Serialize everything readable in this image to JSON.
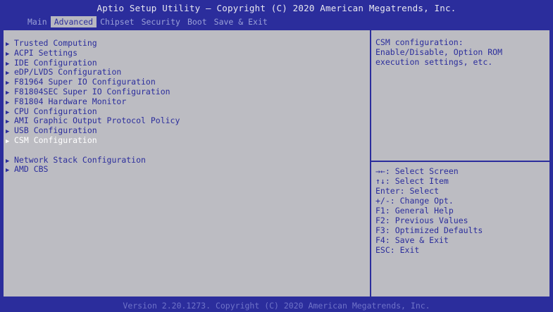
{
  "title": "Aptio Setup Utility – Copyright (C) 2020 American Megatrends, Inc.",
  "tabs": [
    "Main",
    "Advanced",
    "Chipset",
    "Security",
    "Boot",
    "Save & Exit"
  ],
  "active_tab": "Advanced",
  "menu": [
    "Trusted Computing",
    "ACPI Settings",
    "IDE Configuration",
    "eDP/LVDS Configuration",
    "F81964 Super IO Configuration",
    "F81804SEC Super IO Configuration",
    "F81804 Hardware Monitor",
    "CPU Configuration",
    "AMI Graphic Output Protocol Policy",
    "USB Configuration",
    "CSM Configuration",
    "Network Stack Configuration",
    "AMD CBS"
  ],
  "selected_item": "CSM Configuration",
  "help": [
    "CSM configuration:",
    "Enable/Disable, Option ROM",
    "execution settings, etc."
  ],
  "keys": [
    "→←: Select Screen",
    "↑↓: Select Item",
    "Enter: Select",
    "+/-: Change Opt.",
    "F1: General Help",
    "F2: Previous Values",
    "F3: Optimized Defaults",
    "F4: Save & Exit",
    "ESC: Exit"
  ],
  "footer": "Version 2.20.1273. Copyright (C) 2020 American Megatrends, Inc.",
  "colors": {
    "background": "#2b2d9c",
    "panel": "#bcbcc2",
    "text": "#2b2d9c",
    "highlight": "#ffffff"
  }
}
